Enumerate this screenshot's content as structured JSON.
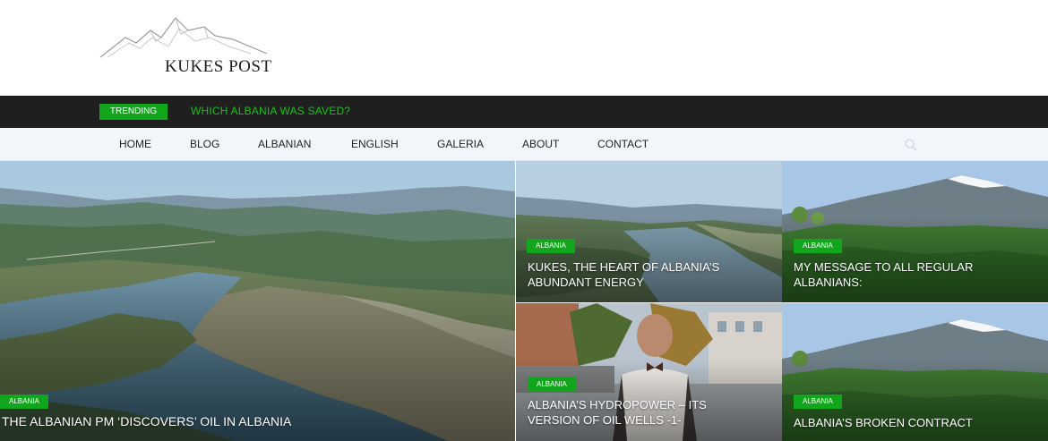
{
  "header": {
    "logo_text": "KUKES POST"
  },
  "trending": {
    "label": "TRENDING",
    "headline": "WHICH ALBANIA WAS SAVED?"
  },
  "nav": {
    "items": [
      "HOME",
      "BLOG",
      "ALBANIAN",
      "ENGLISH",
      "GALERIA",
      "ABOUT",
      "CONTACT"
    ],
    "search_icon": "search-icon"
  },
  "posts": [
    {
      "category": "ALBANIA",
      "title": "THE ALBANIAN PM ‘DISCOVERS’ OIL IN ALBANIA"
    },
    {
      "category": "ALBANIA",
      "title": "KUKES, THE HEART OF ALBANIA’S ABUNDANT ENERGY"
    },
    {
      "category": "ALBANIA",
      "title": "MY MESSAGE TO ALL REGULAR ALBANIANS:"
    },
    {
      "category": "ALBANIA",
      "title": "ALBANIA’S HYDROPOWER – ITS VERSION OF OIL WELLS -1-"
    },
    {
      "category": "ALBANIA",
      "title": "ALBANIA’S BROKEN CONTRACT"
    }
  ],
  "colors": {
    "accent": "#11a61c",
    "trending_text": "#19c21a",
    "topbar": "#1f1f1f",
    "nav_bg": "#f2f6fa"
  }
}
